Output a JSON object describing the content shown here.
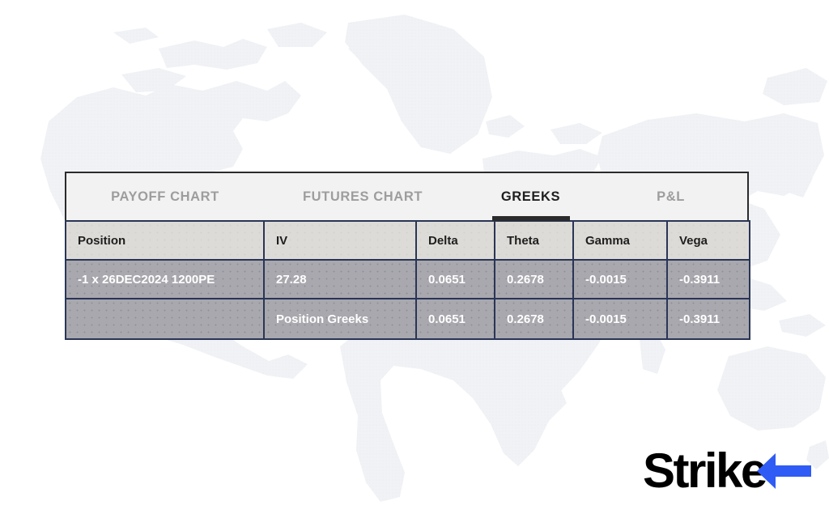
{
  "background": {
    "map_label": "world-map-watermark",
    "map_color": "#f0f2f5",
    "page_color": "#ffffff"
  },
  "tabs": {
    "items": [
      {
        "id": "payoff-chart",
        "label": "PAYOFF CHART",
        "active": false
      },
      {
        "id": "futures-chart",
        "label": "FUTURES CHART",
        "active": false
      },
      {
        "id": "greeks",
        "label": "GREEKS",
        "active": true
      },
      {
        "id": "pl",
        "label": "P&L",
        "active": false
      }
    ],
    "active_id": "greeks",
    "active_color": "#1e1e1e",
    "inactive_color": "#9d9d9d",
    "underline_color": "#2b2b2b"
  },
  "table": {
    "columns": [
      "Position",
      "IV",
      "Delta",
      "Theta",
      "Gamma",
      "Vega"
    ],
    "rows": [
      {
        "position": "-1 x 26DEC2024  1200PE",
        "iv": "27.28",
        "delta": "0.0651",
        "theta": "0.2678",
        "gamma": "-0.0015",
        "vega": "-0.3911"
      },
      {
        "position": "",
        "iv": "Position Greeks",
        "delta": "0.0651",
        "theta": "0.2678",
        "gamma": "-0.0015",
        "vega": "-0.3911"
      }
    ],
    "header_bg": "#dddbd7",
    "row_bg": "#a8a8ae",
    "border_color": "#2a3556",
    "row_text_color": "#ffffff",
    "header_text_color": "#1e1e1e"
  },
  "logo": {
    "text": "Strike",
    "wordmark_color": "#000000",
    "accent_color": "#2f5cf5",
    "accent_shape": "left-arrow"
  }
}
